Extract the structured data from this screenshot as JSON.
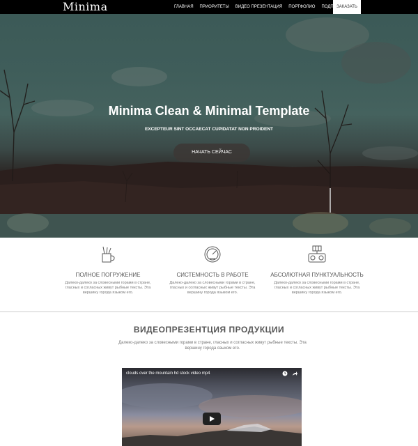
{
  "nav": {
    "logo": "Minima",
    "items": [
      "ГЛАВНАЯ",
      "ПРИОРИТЕТЫ",
      "ВИДЕО ПРЕЗЕНТАЦИЯ",
      "ПОРТФОЛИО",
      "ПОДПИСКА"
    ],
    "order_label": "ЗАКАЗАТЬ"
  },
  "hero": {
    "title": "Minima Clean & Minimal Template",
    "subtitle": "EXCEPTEUR SINT OCCAECAT CUPIDATAT NON PROIDENT",
    "button_label": "НАЧАТЬ СЕЙЧАС"
  },
  "features": [
    {
      "icon": "pencil-cup-icon",
      "title": "ПОЛНОЕ ПОГРУЖЕНИЕ",
      "text": "Далеко-далеко за словесными горами в стране, гласных и согласных живут рыбные тексты. Эта вершину города языком его."
    },
    {
      "icon": "speedometer-icon",
      "title": "СИСТЕМНОСТЬ В РАБОТЕ",
      "text": "Далеко-далеко за словесными горами в стране, гласных и согласных живут рыбные тексты. Эта вершину города языком его."
    },
    {
      "icon": "machine-icon",
      "title": "АБСОЛЮТНАЯ ПУНКТУАЛЬНОСТЬ",
      "text": "Далеко-далеко за словесными горами в стране, гласных и согласных живут рыбные тексты. Эта вершину города языком его."
    }
  ],
  "video_section": {
    "title": "ВИДЕОПРЕЗЕНТЦИЯ ПРОДУКЦИИ",
    "text": "Далеко-далеко за словесными горами в стране, гласных и согласных живут рыбные тексты. Эта вершину города языком его.",
    "video_title": "clouds over the mountain hd stock video mp4"
  }
}
